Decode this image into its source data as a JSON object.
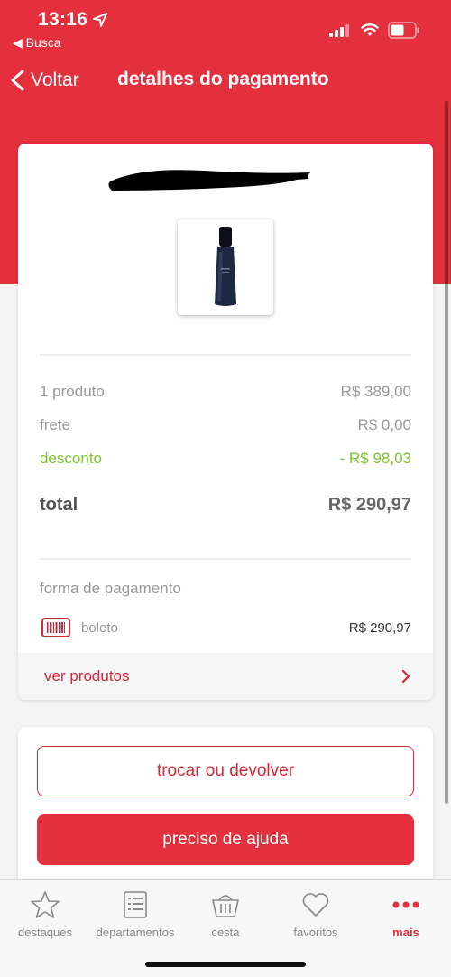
{
  "status_bar": {
    "time": "13:16",
    "back_app": "◀ Busca"
  },
  "nav": {
    "back_label": "Voltar",
    "title": "detalhes do pagamento"
  },
  "summary": {
    "rows": [
      {
        "label": "1 produto",
        "value": "R$ 389,00"
      },
      {
        "label": "frete",
        "value": "R$ 0,00"
      },
      {
        "label": "desconto",
        "value": "- R$ 98,03"
      }
    ],
    "total_label": "total",
    "total_value": "R$ 290,97"
  },
  "payment": {
    "section_label": "forma de pagamento",
    "method": "boleto",
    "method_icon": "barcode-icon",
    "amount": "R$ 290,97"
  },
  "ver_produtos": "ver produtos",
  "actions": {
    "exchange_label": "trocar ou devolver",
    "help_label": "preciso de ajuda"
  },
  "tabs": [
    {
      "label": "destaques",
      "icon": "star-icon"
    },
    {
      "label": "departamentos",
      "icon": "list-icon"
    },
    {
      "label": "cesta",
      "icon": "basket-icon"
    },
    {
      "label": "favoritos",
      "icon": "heart-icon"
    },
    {
      "label": "mais",
      "icon": "more-icon",
      "active": true
    }
  ],
  "colors": {
    "brand": "#e3303c",
    "discount": "#7dc42e"
  }
}
